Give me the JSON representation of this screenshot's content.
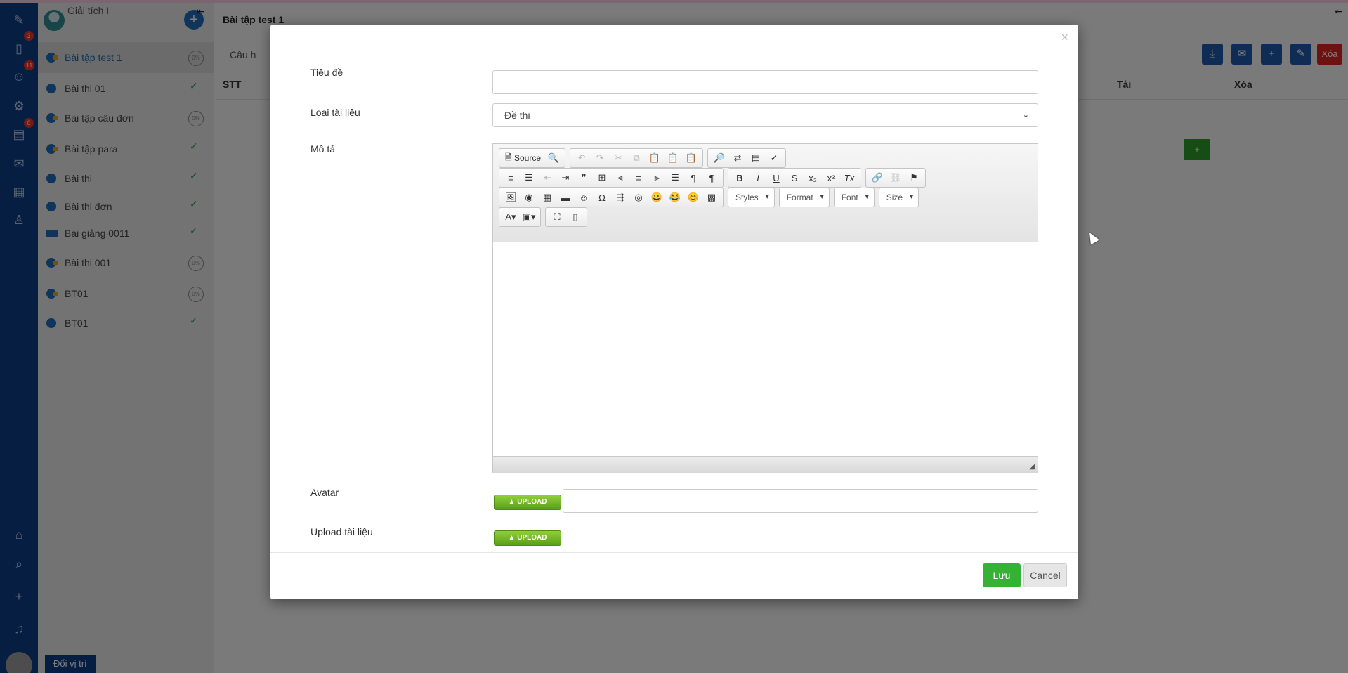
{
  "rail": {
    "badges": [
      "3",
      "11",
      "0"
    ]
  },
  "sidebar": {
    "course_title": "Giải tích I",
    "add_icon": "plus-icon",
    "items": [
      {
        "label": "Bài tập test 1",
        "icon": "key",
        "status": "0%"
      },
      {
        "label": "Bài thi 01",
        "icon": "clock",
        "status": "✓"
      },
      {
        "label": "Bài tập câu đơn",
        "icon": "key",
        "status": "0%"
      },
      {
        "label": "Bài tập para",
        "icon": "key",
        "status": "✓"
      },
      {
        "label": "Bài thi",
        "icon": "clock",
        "status": "✓"
      },
      {
        "label": "Bài thi đơn",
        "icon": "clock",
        "status": "✓"
      },
      {
        "label": "Bài giảng 0011",
        "icon": "book",
        "status": "✓"
      },
      {
        "label": "Bài thi 001",
        "icon": "key",
        "status": "0%"
      },
      {
        "label": "BT01",
        "icon": "key",
        "status": "0%"
      },
      {
        "label": "BT01",
        "icon": "clock",
        "status": "✓"
      }
    ],
    "bottom_button": "Đổi vị trí"
  },
  "main": {
    "title": "Bài tập test 1",
    "tab": "Câu h",
    "delete_button": "Xóa",
    "columns": {
      "stt": "STT",
      "tai": "Tải",
      "xoa": "Xóa"
    },
    "green_button": "+"
  },
  "modal": {
    "close": "×",
    "fields": {
      "title_label": "Tiêu đề",
      "title_value": "",
      "type_label": "Loại tài liệu",
      "type_value": "Đề thi",
      "desc_label": "Mô tả",
      "avatar_label": "Avatar",
      "upload_label": "Upload tài liệu",
      "upload_button": "▲ UPLOAD"
    },
    "editor": {
      "source_label": "Source",
      "combos": {
        "styles": "Styles",
        "format": "Format",
        "font": "Font",
        "size": "Size"
      }
    },
    "save_button": "Lưu",
    "cancel_button": "Cancel"
  }
}
